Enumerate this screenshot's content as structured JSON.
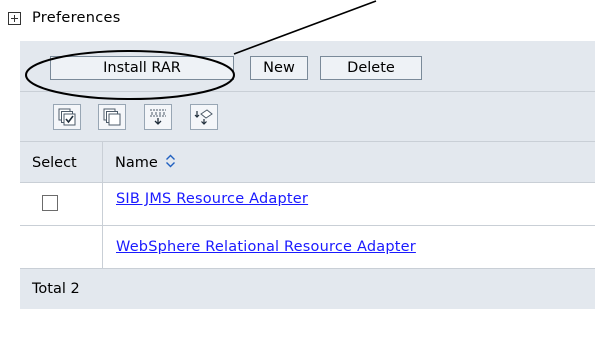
{
  "preferences": {
    "label": "Preferences",
    "expander_icon": "plus-box-icon"
  },
  "toolbar": {
    "install_label": "Install RAR",
    "new_label": "New",
    "delete_label": "Delete"
  },
  "icon_toolbar": {
    "icons": [
      "select-all-icon",
      "deselect-all-icon",
      "show-filter-icon",
      "clear-filter-icon"
    ]
  },
  "table": {
    "columns": {
      "select": "Select",
      "name": "Name"
    },
    "sort_icon": "sort-toggle-icon",
    "rows": [
      {
        "name": "SIB JMS Resource Adapter",
        "has_checkbox": true
      },
      {
        "name": "WebSphere Relational Resource Adapter",
        "has_checkbox": false
      }
    ],
    "total": "Total 2"
  },
  "colors": {
    "header_bg": "#e3e8ee",
    "link": "#1a1aff",
    "border": "#c9cfd6"
  }
}
